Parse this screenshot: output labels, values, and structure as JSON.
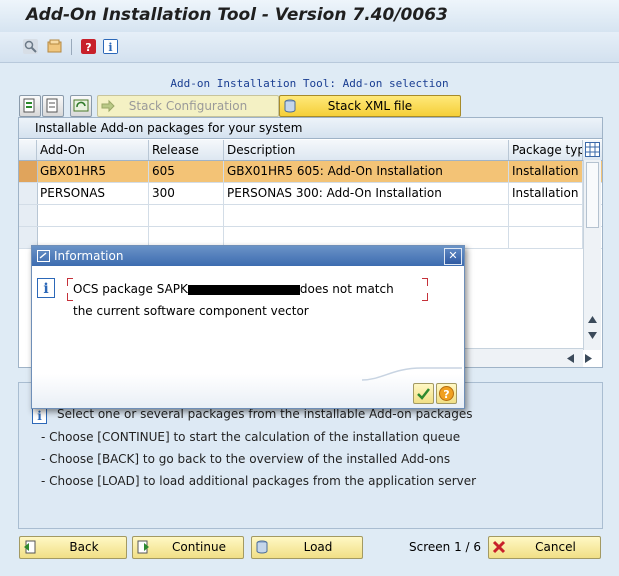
{
  "window": {
    "title": "Add-On Installation Tool - Version 7.40/0063"
  },
  "toolbar": {
    "icons": [
      "search-icon",
      "settings-icon",
      "help-icon",
      "info-icon"
    ]
  },
  "screen": {
    "title": "Add-on Installation Tool: Add-on selection"
  },
  "stack_buttons": {
    "stack_configuration": "Stack Configuration",
    "stack_xml_file": "Stack XML file"
  },
  "table": {
    "caption": "Installable Add-on packages for your system",
    "columns": [
      "Add-On",
      "Release",
      "Description",
      "Package type"
    ],
    "rows": [
      {
        "addon": "GBX01HR5",
        "release": "605",
        "description": "GBX01HR5 605: Add-On Installation",
        "package_type": "Installation",
        "selected": true
      },
      {
        "addon": "PERSONAS",
        "release": "300",
        "description": "PERSONAS 300: Add-On Installation",
        "package_type": "Installation",
        "selected": false
      }
    ]
  },
  "instructions": {
    "lines": [
      "Select one or several packages from the installable Add-on packages",
      "- Choose [CONTINUE] to start the calculation of the installation queue",
      "- Choose [BACK] to go back to the overview of the installed Add-ons",
      "- Choose [LOAD] to load additional packages from the application server"
    ]
  },
  "footer": {
    "back": "Back",
    "continue": "Continue",
    "load": "Load",
    "screen_count": "Screen 1 / 6",
    "cancel": "Cancel"
  },
  "dialog": {
    "title": "Information",
    "message_prefix": "OCS package SAPK",
    "message_suffix": "does not match",
    "message_line2": "the current software component vector",
    "close_symbol": "✕"
  },
  "colors": {
    "selected_row": "#f3c376",
    "dialog_title": "#3d6cb0",
    "button_yellow": "#f1df86"
  }
}
